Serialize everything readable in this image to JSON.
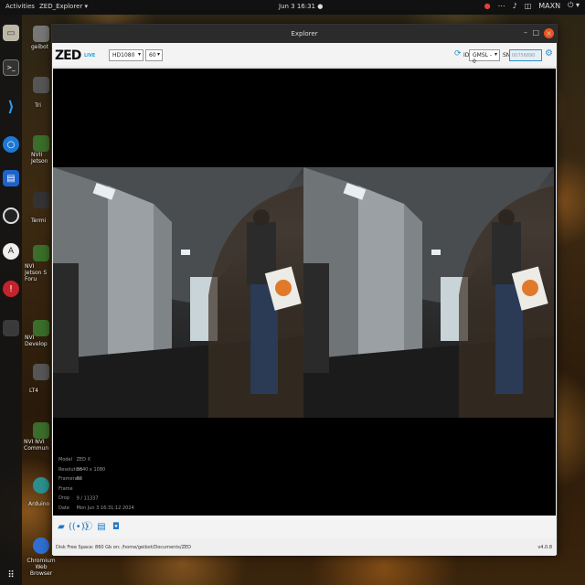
{
  "topbar": {
    "activities": "Activities",
    "app_menu": "ZED_Explorer ▾",
    "clock": "Jun 3  16:31  ●",
    "tray_items": [
      "●",
      "⋯",
      "♪",
      "◫",
      "MAXN",
      "⏻ ▾"
    ]
  },
  "desktop": {
    "labels": [
      "geibot",
      "Tri",
      "NVII Jetson",
      "Termi",
      "NVI Jetson S Foru",
      "NVI Develop",
      "LT4",
      "NVI NVI Commun",
      "Arduino ID",
      "Chromium Web Browser"
    ]
  },
  "window": {
    "title": "Explorer",
    "controls": {
      "minimize": "–",
      "maximize": "□",
      "close": "×"
    }
  },
  "toolbar": {
    "logo": "ZED",
    "live_badge": "LIVE",
    "resolution": "HD1080",
    "fps": "60",
    "id_label": "ID",
    "id_value": "GMSL - 0",
    "sn_label": "SN",
    "sn_placeholder": "00756890"
  },
  "info": {
    "model_k": "Model",
    "model_v": "ZED X",
    "resolution_k": "Resolution",
    "resolution_v": "3840 x 1080",
    "framerate_k": "Framerate",
    "framerate_v": "60",
    "framedrop_k": "Frame Drop",
    "framedrop_v": "9 / 11337",
    "date_k": "Date",
    "date_v": "Mon Jun 3 16:31:12 2024"
  },
  "status": {
    "disk": "Disk Free Space: 860 Gb  on: /home/geibot/Documents/ZED",
    "version": "v4.0.8"
  },
  "colors": {
    "accent": "#2a8fd0",
    "close": "#e95420"
  },
  "icons": {
    "bottombar": [
      "folder-icon",
      "signal-icon",
      "info-icon",
      "film-icon",
      "camera-icon"
    ]
  }
}
